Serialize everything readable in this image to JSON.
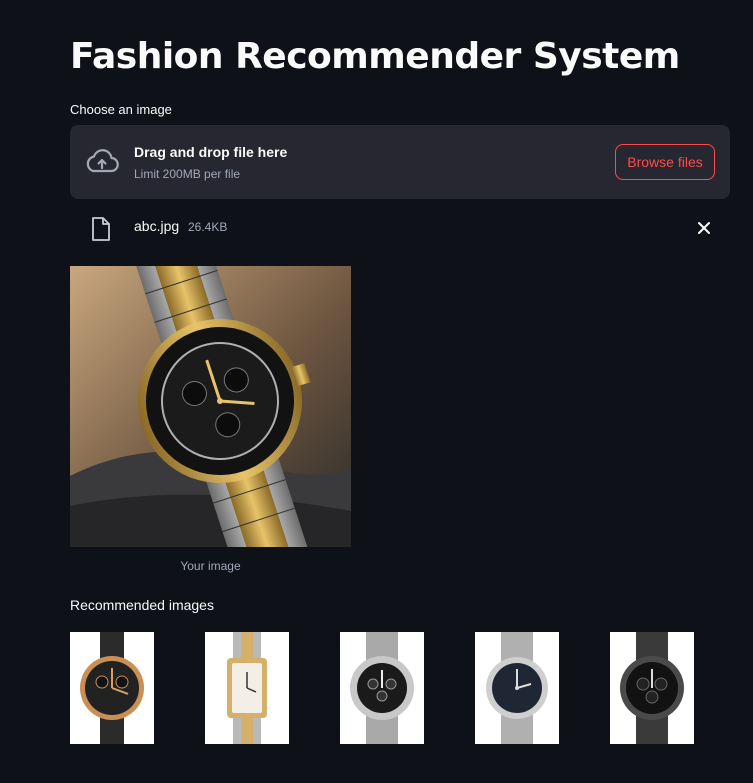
{
  "page": {
    "title": "Fashion Recommender System"
  },
  "uploader": {
    "label": "Choose an image",
    "drop_text": "Drag and drop file here",
    "limit_text": "Limit 200MB per file",
    "browse_label": "Browse files",
    "cloud_icon": "cloud-upload-icon"
  },
  "uploaded_file": {
    "name": "abc.jpg",
    "size": "26.4KB",
    "file_icon": "file-icon",
    "remove_icon": "close-icon"
  },
  "preview": {
    "caption": "Your image"
  },
  "recommendations": {
    "heading": "Recommended images",
    "items": [
      {
        "kind": "black leather strap watch"
      },
      {
        "kind": "two-tone rectangular watch"
      },
      {
        "kind": "steel chronograph watch"
      },
      {
        "kind": "steel dress watch"
      },
      {
        "kind": "black steel chronograph watch"
      }
    ]
  },
  "colors": {
    "background": "#0e1117",
    "panel": "#262730",
    "accent": "#ff4b4b",
    "text": "#fafafa",
    "muted": "#a3a8b8"
  }
}
